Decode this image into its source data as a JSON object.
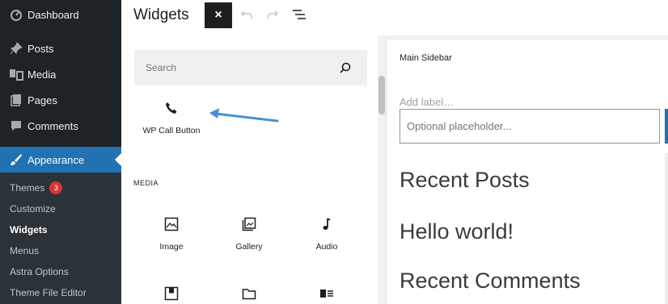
{
  "sidebar": {
    "items": [
      {
        "label": "Dashboard",
        "icon": "dashboard-icon"
      },
      {
        "label": "Posts",
        "icon": "pin-icon"
      },
      {
        "label": "Media",
        "icon": "media-icon"
      },
      {
        "label": "Pages",
        "icon": "pages-icon"
      },
      {
        "label": "Comments",
        "icon": "comment-icon"
      },
      {
        "label": "Appearance",
        "icon": "brush-icon",
        "active": true
      }
    ],
    "submenu": [
      {
        "label": "Themes",
        "badge": "3"
      },
      {
        "label": "Customize"
      },
      {
        "label": "Widgets",
        "current": true
      },
      {
        "label": "Menus"
      },
      {
        "label": "Astra Options"
      },
      {
        "label": "Theme File Editor"
      }
    ],
    "active_color": "#2271b1",
    "background": "#1d2327"
  },
  "header": {
    "title": "Widgets",
    "close_label": "×",
    "undo_icon": "undo-icon",
    "redo_icon": "redo-icon",
    "list_view_icon": "list-view-icon"
  },
  "inserter": {
    "search_placeholder": "Search",
    "featured_block": {
      "label": "WP Call Button",
      "icon": "phone-icon"
    },
    "arrow_color": "#4a90d9",
    "category": "MEDIA",
    "blocks": [
      {
        "label": "Image",
        "icon": "image-icon"
      },
      {
        "label": "Gallery",
        "icon": "gallery-icon"
      },
      {
        "label": "Audio",
        "icon": "audio-icon"
      },
      {
        "label": "",
        "icon": "cover-icon"
      },
      {
        "label": "",
        "icon": "file-icon"
      },
      {
        "label": "",
        "icon": "media-text-icon"
      }
    ]
  },
  "canvas": {
    "area_title": "Main Sidebar",
    "field_label": "Add label…",
    "field_placeholder": "Optional placeholder...",
    "headings": [
      "Recent Posts",
      "Hello world!",
      "Recent Comments"
    ]
  }
}
